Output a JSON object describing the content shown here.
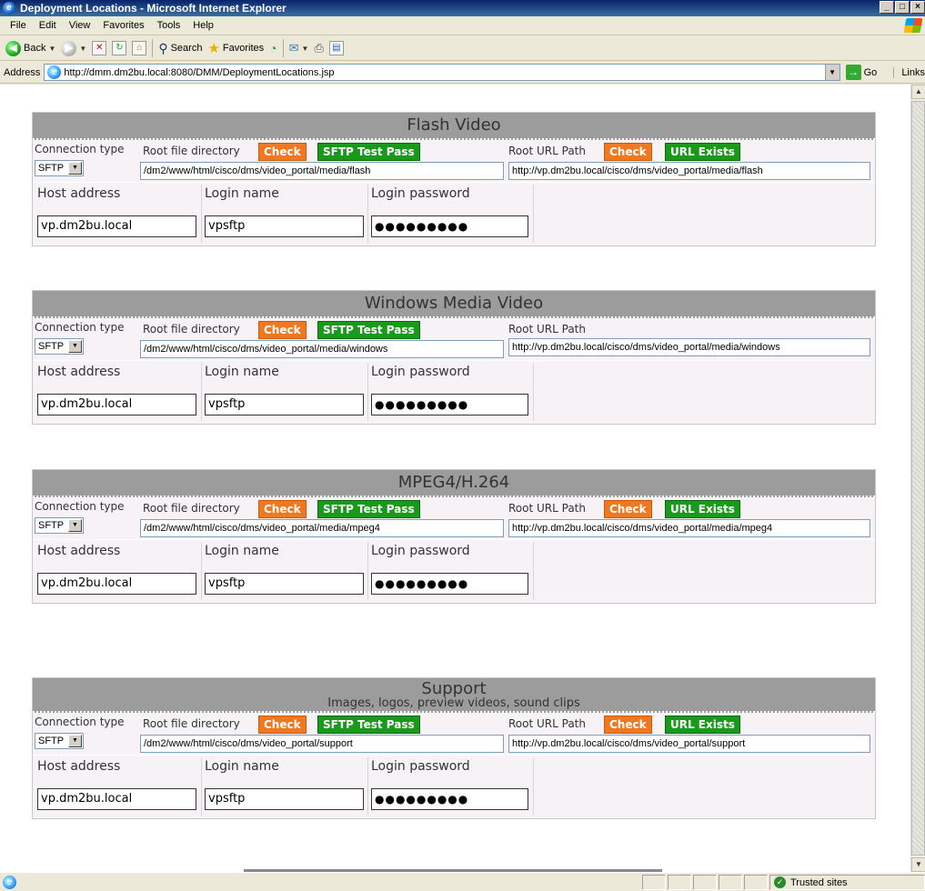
{
  "window": {
    "title": "Deployment Locations - Microsoft Internet Explorer",
    "minimize": "_",
    "maximize": "□",
    "close": "×"
  },
  "menu": [
    "File",
    "Edit",
    "View",
    "Favorites",
    "Tools",
    "Help"
  ],
  "toolbar": {
    "back": "Back",
    "search": "Search",
    "favorites": "Favorites"
  },
  "address": {
    "label": "Address",
    "url": "http://dmm.dm2bu.local:8080/DMM/DeploymentLocations.jsp",
    "go": "Go",
    "links": "Links"
  },
  "labels": {
    "connection_type": "Connection type",
    "root_file_directory": "Root file directory",
    "root_url_path": "Root URL Path",
    "host_address": "Host address",
    "login_name": "Login name",
    "login_password": "Login password",
    "check": "Check",
    "sftp_test_pass": "SFTP Test Pass",
    "url_exists": "URL Exists"
  },
  "sections": [
    {
      "title": "Flash Video",
      "connection_type": "SFTP",
      "root_dir": "/dm2/www/html/cisco/dms/video_portal/media/flash",
      "root_url": "http://vp.dm2bu.local/cisco/dms/video_portal/media/flash",
      "host": "vp.dm2bu.local",
      "login": "vpsftp",
      "password": "●●●●●●●●●"
    },
    {
      "title": "Windows Media Video",
      "connection_type": "SFTP",
      "root_dir": "/dm2/www/html/cisco/dms/video_portal/media/windows",
      "root_url": "http://vp.dm2bu.local/cisco/dms/video_portal/media/windows",
      "host": "vp.dm2bu.local",
      "login": "vpsftp",
      "password": "●●●●●●●●●"
    },
    {
      "title": "MPEG4/H.264",
      "connection_type": "SFTP",
      "root_dir": "/dm2/www/html/cisco/dms/video_portal/media/mpeg4",
      "root_url": "http://vp.dm2bu.local/cisco/dms/video_portal/media/mpeg4",
      "host": "vp.dm2bu.local",
      "login": "vpsftp",
      "password": "●●●●●●●●●"
    },
    {
      "title": "Support",
      "subtitle": "Images, logos, preview videos, sound clips",
      "connection_type": "SFTP",
      "root_dir": "/dm2/www/html/cisco/dms/video_portal/support",
      "root_url": "http://vp.dm2bu.local/cisco/dms/video_portal/support",
      "host": "vp.dm2bu.local",
      "login": "vpsftp",
      "password": "●●●●●●●●●"
    }
  ],
  "status": {
    "zone": "Trusted sites"
  }
}
